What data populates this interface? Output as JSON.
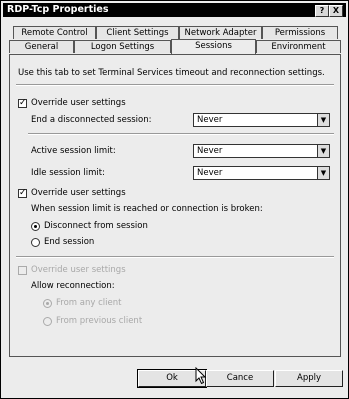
{
  "window": {
    "title": "RDP-Tcp Properties",
    "help_glyph": "?",
    "close_glyph": "X"
  },
  "tabs_row1": [
    {
      "label": "Remote Control"
    },
    {
      "label": "Client Settings"
    },
    {
      "label": "Network Adapter"
    },
    {
      "label": "Permissions"
    }
  ],
  "tabs_row2": [
    {
      "label": "General"
    },
    {
      "label": "Logon Settings"
    },
    {
      "label": "Sessions",
      "active": true
    },
    {
      "label": "Environment"
    }
  ],
  "sessions": {
    "intro": "Use this tab to set Terminal Services timeout and reconnection settings.",
    "group1": {
      "override_label": "Override user settings",
      "override_checked": true,
      "disconnected_label": "End a disconnected session:",
      "disconnected_value": "Never",
      "active_label": "Active session limit:",
      "active_value": "Never",
      "idle_label": "Idle session limit:",
      "idle_value": "Never"
    },
    "group2": {
      "override_label": "Override user settings",
      "override_checked": true,
      "prompt": "When session limit is reached or connection is broken:",
      "opt_disconnect": "Disconnect from session",
      "opt_end": "End session",
      "selected": "disconnect"
    },
    "group3": {
      "override_label": "Override user settings",
      "override_checked": false,
      "prompt": "Allow reconnection:",
      "opt_any": "From any client",
      "opt_previous": "From previous client",
      "selected": "any"
    }
  },
  "buttons": {
    "ok": "Ok",
    "cancel": "Cance",
    "apply": "Apply"
  },
  "glyphs": {
    "check": "✓",
    "dropdown_arrow": "▼"
  }
}
